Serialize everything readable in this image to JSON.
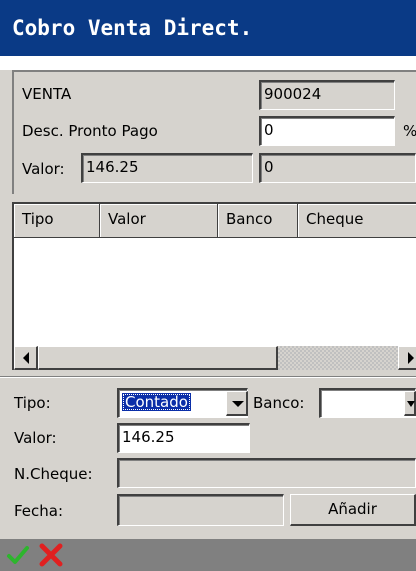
{
  "window": {
    "title": "Cobro Venta Direct."
  },
  "summary": {
    "venta_label": "VENTA",
    "venta_value": "900024",
    "desc_label": "Desc. Pronto Pago",
    "desc_value": "0",
    "desc_unit": "%",
    "valor_label": "Valor:",
    "valor_value": "146.25",
    "total_value": "0"
  },
  "grid": {
    "columns": [
      "Tipo",
      "Valor",
      "Banco",
      "Cheque"
    ],
    "rows": []
  },
  "form": {
    "tipo_label": "Tipo:",
    "tipo_selected": "Contado",
    "banco_label": "Banco:",
    "banco_value": "",
    "valor_label": "Valor:",
    "valor_value": "146.25",
    "ncheque_label": "N.Cheque:",
    "ncheque_value": "",
    "fecha_label": "Fecha:",
    "fecha_value": "",
    "add_label": "Añadir"
  },
  "toolbar": {
    "icons": [
      "checkmark-icon",
      "close-icon"
    ],
    "colors": {
      "ok": "#2db52d",
      "cancel": "#e02020"
    }
  }
}
